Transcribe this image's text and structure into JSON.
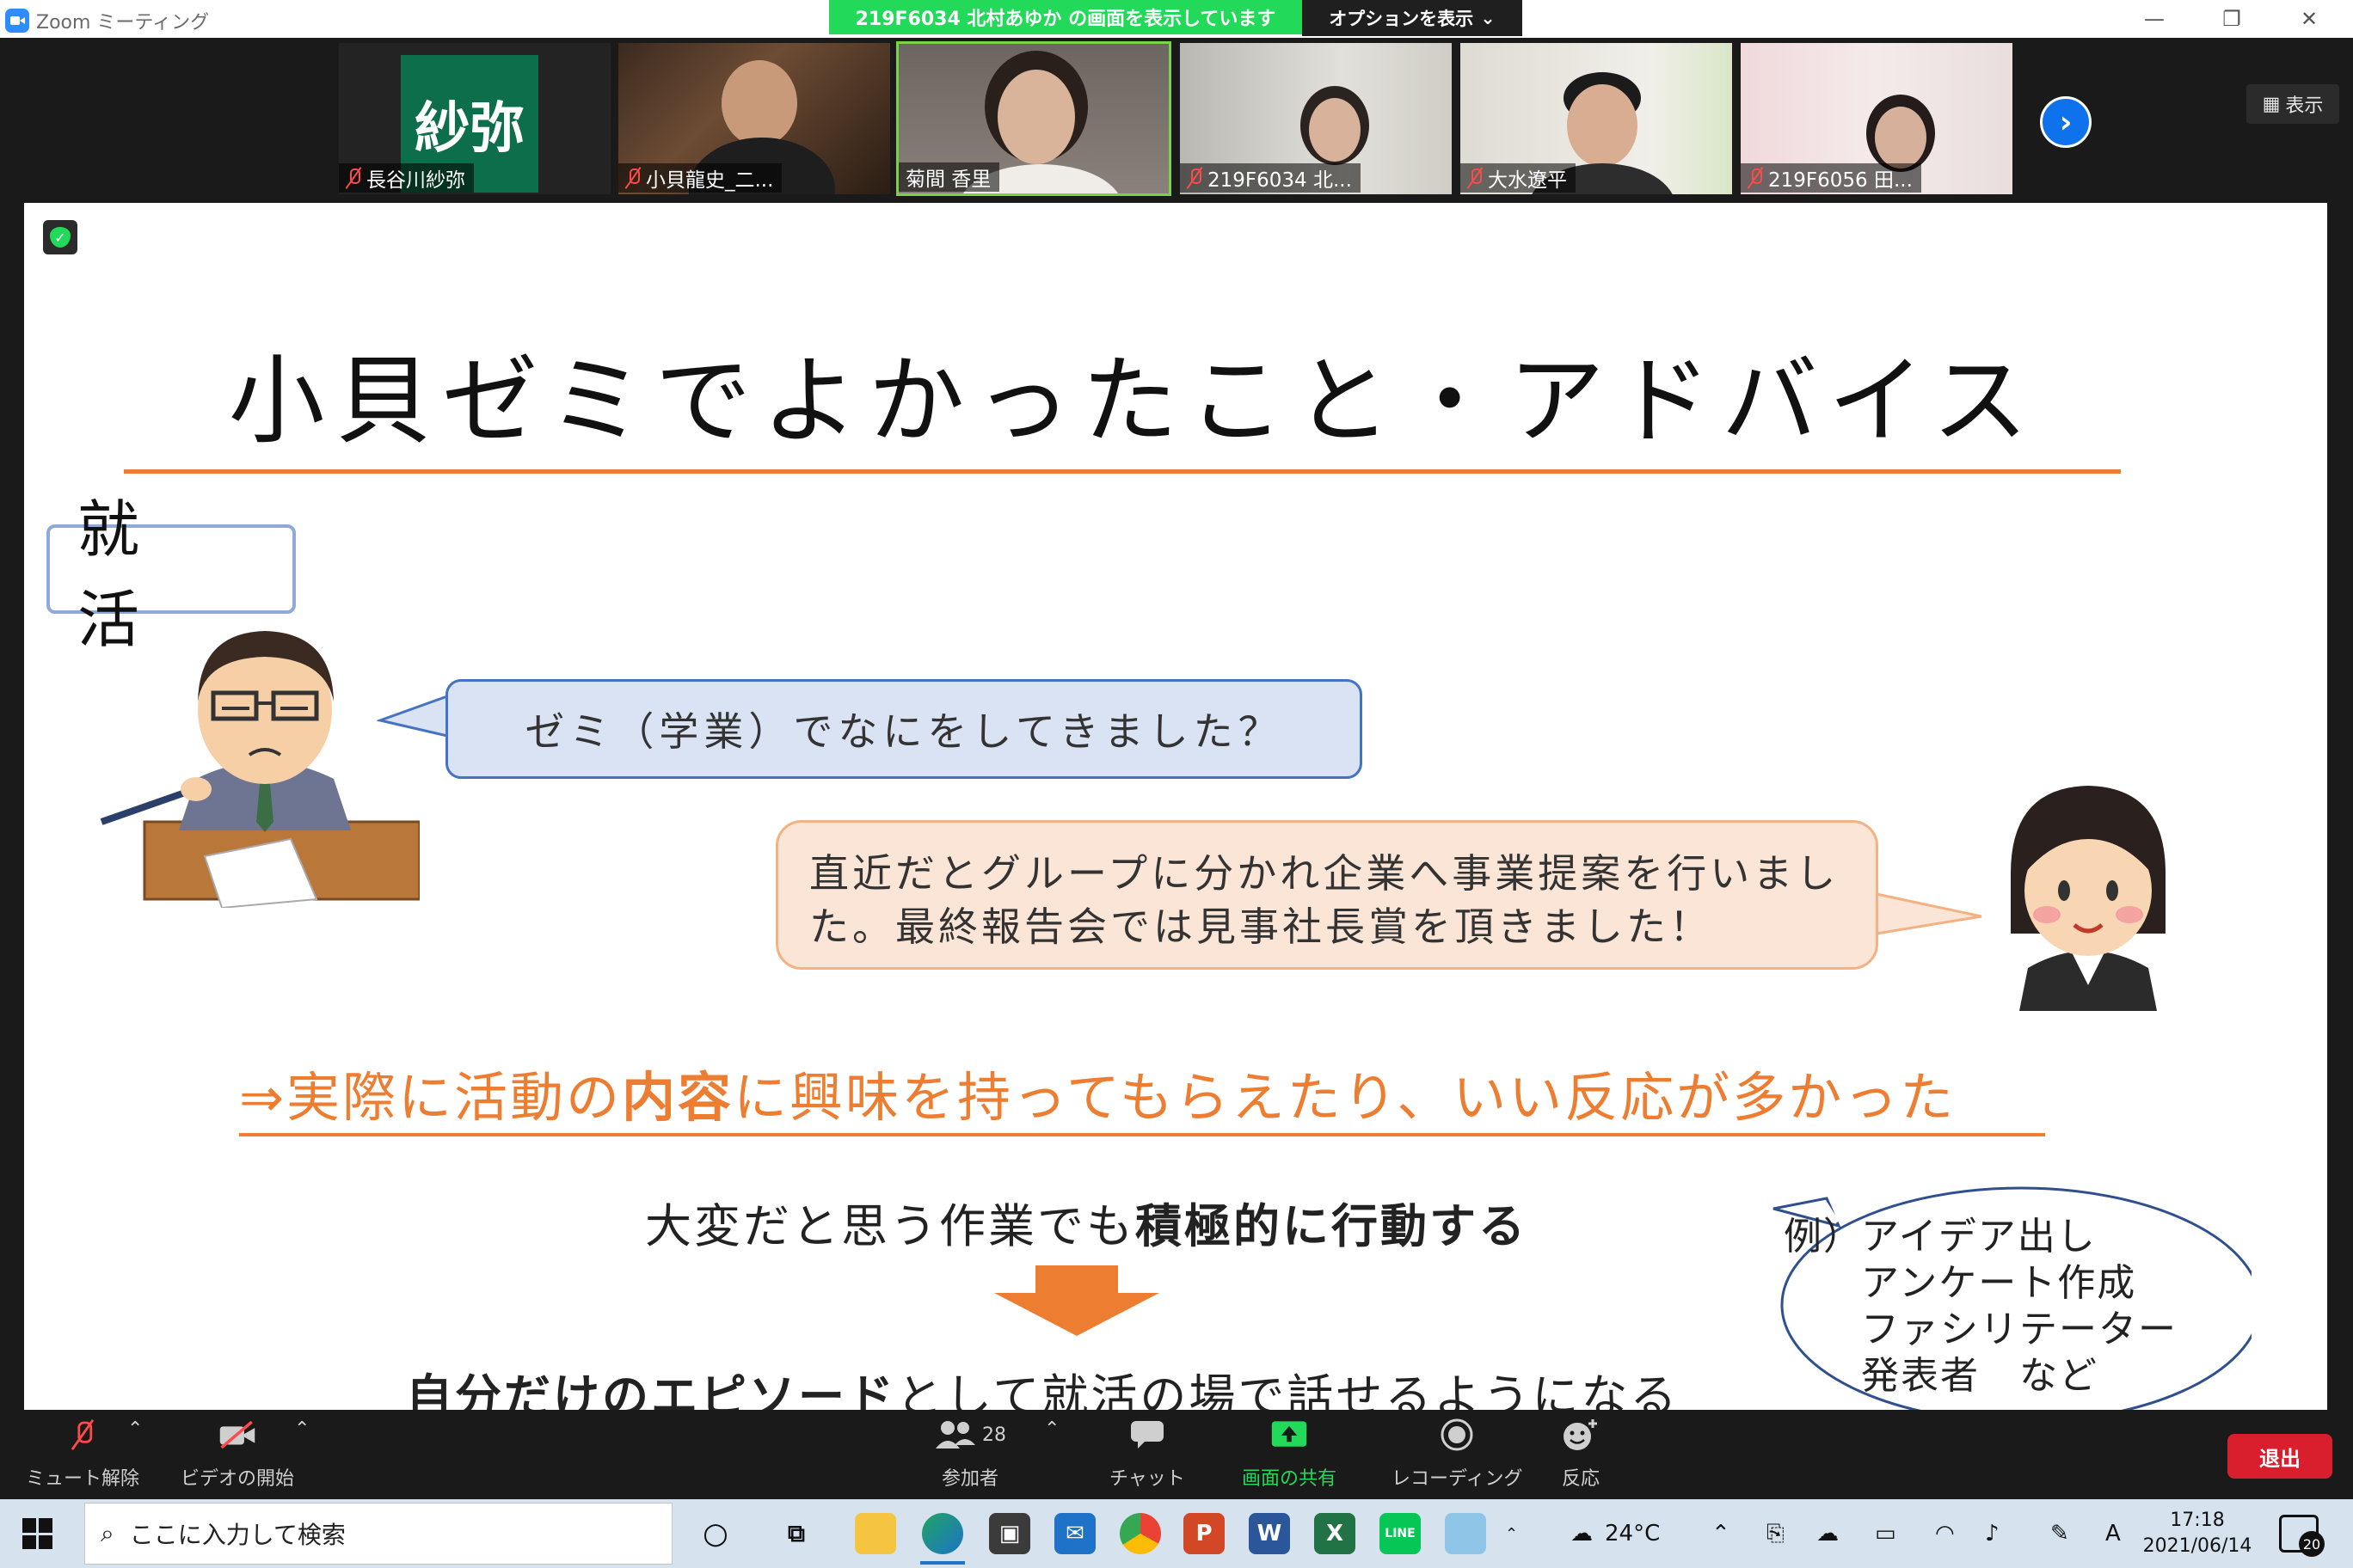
{
  "window": {
    "app_title": "Zoom ミーティング",
    "share_banner": "219F6034 北村あゆか の画面を表示しています",
    "options_label": "オプションを表示",
    "minimize": "—",
    "restore": "❐",
    "close": "✕"
  },
  "participants": [
    {
      "name": "長谷川紗弥",
      "avatar_text": "紗弥",
      "muted": true
    },
    {
      "name": "小貝龍史_二...",
      "muted": true
    },
    {
      "name": "菊間 香里",
      "muted": false,
      "active": true
    },
    {
      "name": "219F6034 北...",
      "muted": true
    },
    {
      "name": "大水遼平",
      "muted": true
    },
    {
      "name": "219F6056 田...",
      "muted": true
    }
  ],
  "view_button": "表示",
  "slide": {
    "title": "小貝ゼミでよかったこと・アドバイス",
    "tag": "就 活",
    "question": "ゼミ（学業）でなにをしてきました？",
    "answer_line1": "直近だとグループに分かれ企業へ事業提案を行いまし",
    "answer_line2": "た。最終報告会では見事社長賞を頂きました！",
    "highlight_pre": "⇒実際に活動の",
    "highlight_bold": "内容",
    "highlight_post": "に興味を持ってもらえたり、いい反応が多かった",
    "action_pre": "大変だと思う作業でも",
    "action_bold": "積極的に行動する",
    "episode_bold": "自分だけのエピソード",
    "episode_post": "として就活の場で話せるようになる",
    "example_prefix": "例）",
    "example_items": [
      "アイデア出し",
      "アンケート作成",
      "ファシリテーター",
      "発表者　など"
    ]
  },
  "controls": {
    "unmute": "ミュート解除",
    "start_video": "ビデオの開始",
    "participants": "参加者",
    "participant_count": "28",
    "chat": "チャット",
    "share": "画面の共有",
    "record": "レコーディング",
    "reactions": "反応",
    "leave": "退出"
  },
  "taskbar": {
    "search_placeholder": "ここに入力して検索",
    "weather": "24°C",
    "time": "17:18",
    "date": "2021/06/14",
    "notifications": "20",
    "ime": "A"
  },
  "colors": {
    "accent_orange": "#ed7d31",
    "banner_green": "#23d959",
    "leave_red": "#d91f2e",
    "question_fill": "#dae3f3",
    "answer_fill": "#fbe5d6"
  }
}
